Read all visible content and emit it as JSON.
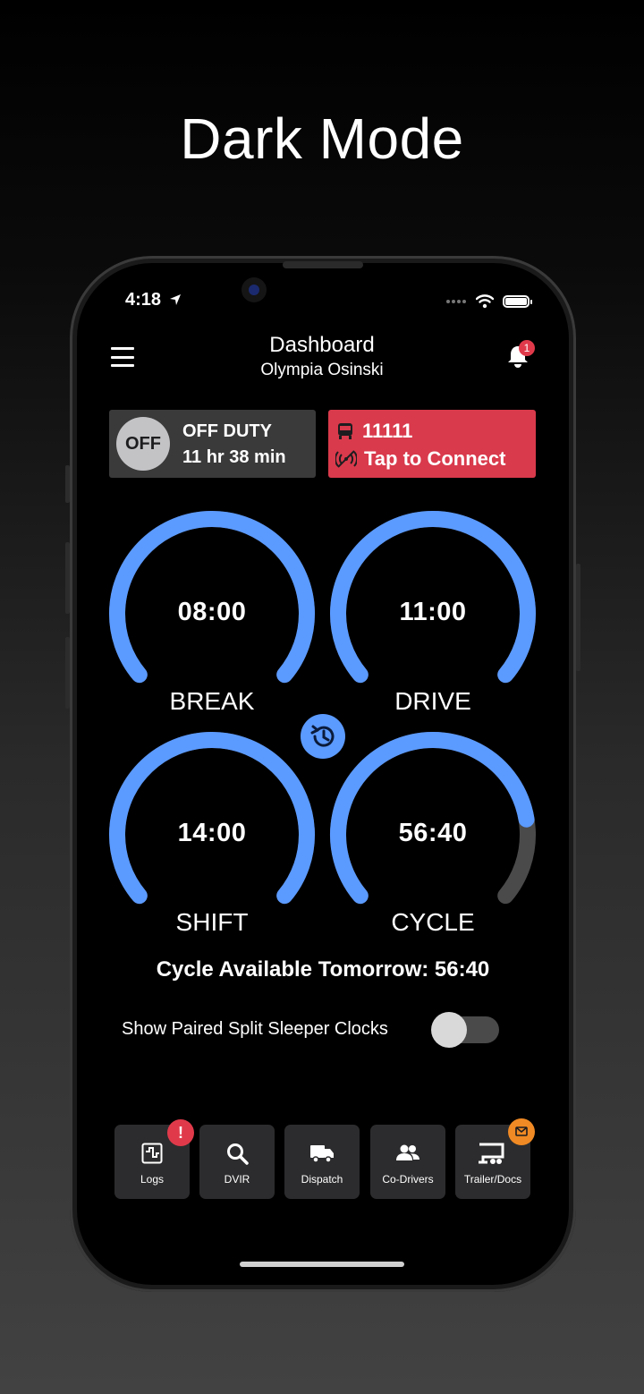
{
  "headline": "Dark Mode",
  "status_bar": {
    "time": "4:18"
  },
  "header": {
    "title": "Dashboard",
    "subtitle": "Olympia Osinski",
    "notification_count": "1"
  },
  "duty": {
    "badge": "OFF",
    "status": "OFF DUTY",
    "time": "11 hr 38 min"
  },
  "vehicle": {
    "id": "11111",
    "connect_label": "Tap to Connect"
  },
  "gauges": [
    {
      "time": "08:00",
      "label": "BREAK",
      "level": 1.0
    },
    {
      "time": "11:00",
      "label": "DRIVE",
      "level": 1.0
    },
    {
      "time": "14:00",
      "label": "SHIFT",
      "level": 1.0
    },
    {
      "time": "56:40",
      "label": "CYCLE",
      "level": 0.81
    }
  ],
  "cycle_available": "Cycle Available Tomorrow: 56:40",
  "split_sleeper": {
    "label": "Show Paired Split Sleeper Clocks",
    "enabled": false
  },
  "nav": [
    {
      "label": "Logs",
      "icon": "logs-icon",
      "badge": "!"
    },
    {
      "label": "DVIR",
      "icon": "search-icon"
    },
    {
      "label": "Dispatch",
      "icon": "truck-icon"
    },
    {
      "label": "Co-Drivers",
      "icon": "people-icon"
    },
    {
      "label": "Trailer/Docs",
      "icon": "trailer-icon",
      "badge_icon": "mail-icon"
    }
  ],
  "colors": {
    "accent_blue": "#5b9aff",
    "alert_red": "#d93a4c",
    "badge_red": "#e03a4a",
    "badge_orange": "#f08a24",
    "track_gray": "#4a4a4a"
  }
}
